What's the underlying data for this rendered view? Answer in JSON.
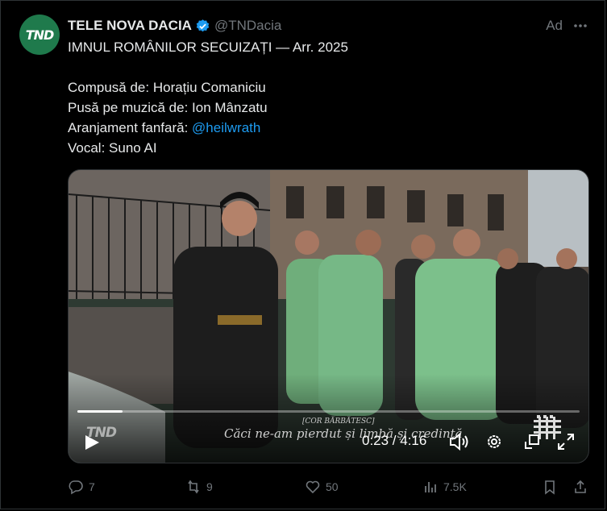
{
  "post": {
    "avatar_text": "TND",
    "display_name": "TELE NOVA DACIA",
    "handle": "@TNDacia",
    "ad_label": "Ad",
    "lines": {
      "title": "IMNUL ROMÂNILOR SECUIZAȚI — Arr. 2025",
      "composer": "Compusă de: Horațiu Comaniciu",
      "lyrics": "Pusă pe muzică de: Ion Mânzatu",
      "arrangement_label": "Aranjament fanfară: ",
      "arrangement_mention": "@heilwrath",
      "vocal": "Vocal: Suno AI"
    }
  },
  "video": {
    "watermark": "TND",
    "caption_tag": "[COR BĂRBĂTESC]",
    "caption_line": "Căci ne-am pierdut și limbă și credință",
    "time": "0:23 / 4:16",
    "progress": 0.09
  },
  "actions": {
    "replies": "7",
    "reposts": "9",
    "likes": "50",
    "views": "7.5K"
  },
  "colors": {
    "accent": "#1d9bf0",
    "muted": "#71767b",
    "text": "#e7e9ea",
    "avatar_bg": "#1f7a4c"
  },
  "icons": [
    "verified-badge-icon",
    "more-icon",
    "play-icon",
    "volume-icon",
    "settings-icon",
    "pip-icon",
    "fullscreen-icon",
    "reply-icon",
    "repost-icon",
    "like-icon",
    "views-icon",
    "bookmark-icon",
    "share-icon"
  ]
}
